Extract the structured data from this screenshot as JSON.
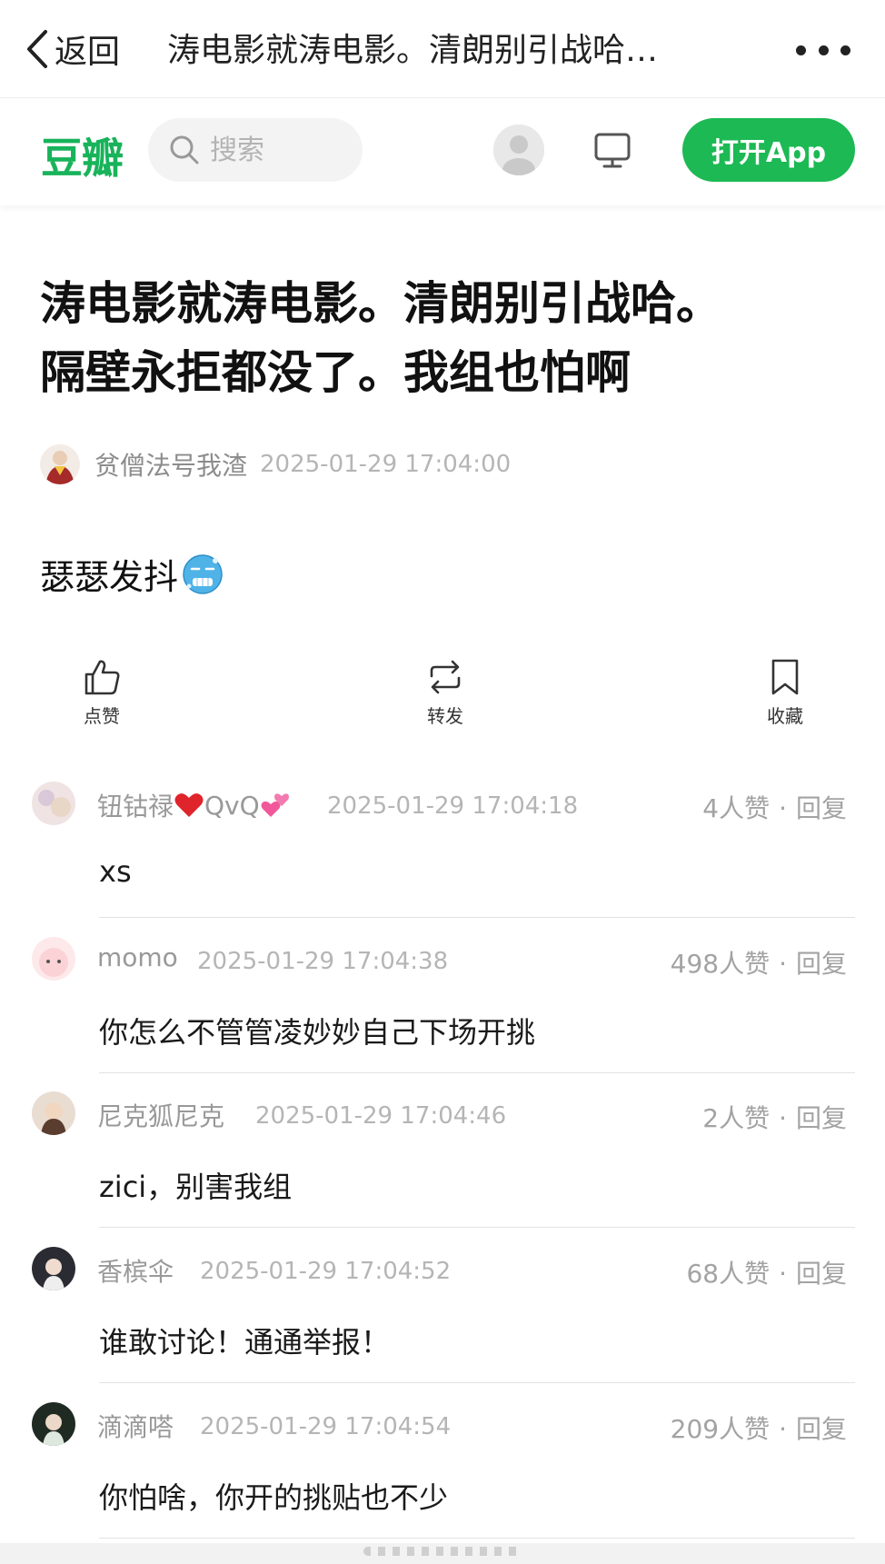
{
  "nav": {
    "back_label": "返回",
    "title": "涛电影就涛电影。清朗别引战哈…"
  },
  "header": {
    "logo": "豆瓣",
    "search_placeholder": "搜索",
    "open_app_label": "打开App",
    "brand_color": "#1db954"
  },
  "post": {
    "title_line1": "涛电影就涛电影。清朗别引战哈。",
    "title_line2": "隔壁永拒都没了。我组也怕啊",
    "author": "贫僧法号我渣",
    "time": "2025-01-29 17:04:00",
    "body": "瑟瑟发抖",
    "body_emoji": "cold-face-emoji"
  },
  "actions": {
    "like": "点赞",
    "repost": "转发",
    "collect": "收藏"
  },
  "comments": [
    {
      "name": "钮钴禄",
      "name_suffix": "QvQ",
      "time": "2025-01-29 17:04:18",
      "likes": "4人赞",
      "reply": "回复",
      "text": "xs"
    },
    {
      "name": "momo",
      "time": "2025-01-29 17:04:38",
      "likes": "498人赞",
      "reply": "回复",
      "text": "你怎么不管管凌妙妙自己下场开挑"
    },
    {
      "name": "尼克狐尼克",
      "time": "2025-01-29 17:04:46",
      "likes": "2人赞",
      "reply": "回复",
      "text": "zici，别害我组"
    },
    {
      "name": "香槟伞",
      "time": "2025-01-29 17:04:52",
      "likes": "68人赞",
      "reply": "回复",
      "text": "谁敢讨论！通通举报！"
    },
    {
      "name": "滴滴嗒",
      "time": "2025-01-29 17:04:54",
      "likes": "209人赞",
      "reply": "回复",
      "text": "你怕啥，你开的挑贴也不少"
    }
  ],
  "separator": "·"
}
